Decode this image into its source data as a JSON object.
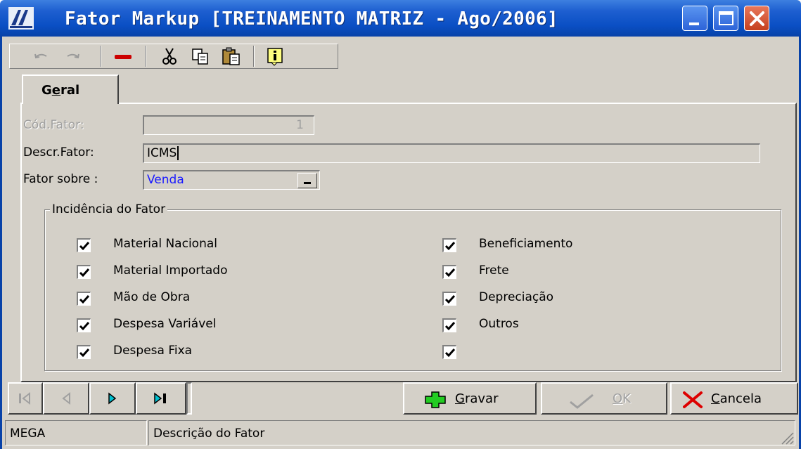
{
  "window": {
    "title": "Fator Markup [TREINAMENTO MATRIZ - Ago/2006]"
  },
  "toolbar": {
    "items": [
      "undo-icon",
      "redo-icon",
      "delete-icon",
      "cut-icon",
      "copy-icon",
      "paste-icon",
      "info-icon"
    ]
  },
  "tabs": [
    {
      "label_pre": "G",
      "label_under": "e",
      "label_post": "ral"
    }
  ],
  "form": {
    "cod_label": "Cód.Fator:",
    "cod_value": "1",
    "descr_label": "Descr.Fator:",
    "descr_value": "ICMS",
    "sobre_label": "Fator sobre :",
    "sobre_value": "Venda"
  },
  "incidencia": {
    "title": "Incidência do Fator",
    "left": [
      {
        "label": "Material Nacional",
        "checked": true
      },
      {
        "label": "Material Importado",
        "checked": true
      },
      {
        "label": "Mão de Obra",
        "checked": true
      },
      {
        "label": "Despesa Variável",
        "checked": true
      },
      {
        "label": "Despesa Fixa",
        "checked": true
      }
    ],
    "right": [
      {
        "label": "Beneficiamento",
        "checked": true
      },
      {
        "label": "Frete",
        "checked": true
      },
      {
        "label": "Depreciação",
        "checked": true
      },
      {
        "label": "Outros",
        "checked": true
      },
      {
        "label": "",
        "checked": true
      }
    ]
  },
  "actions": {
    "gravar": {
      "under": "G",
      "rest": "ravar"
    },
    "ok": {
      "under": "O",
      "rest": "K"
    },
    "cancela": {
      "under": "C",
      "rest": "ancela"
    }
  },
  "status": {
    "user": "MEGA",
    "hint": "Descrição do Fator"
  },
  "colors": {
    "titlebar": "#0a4fc4",
    "face": "#d4d0c8",
    "select_text": "#1a1aff"
  }
}
